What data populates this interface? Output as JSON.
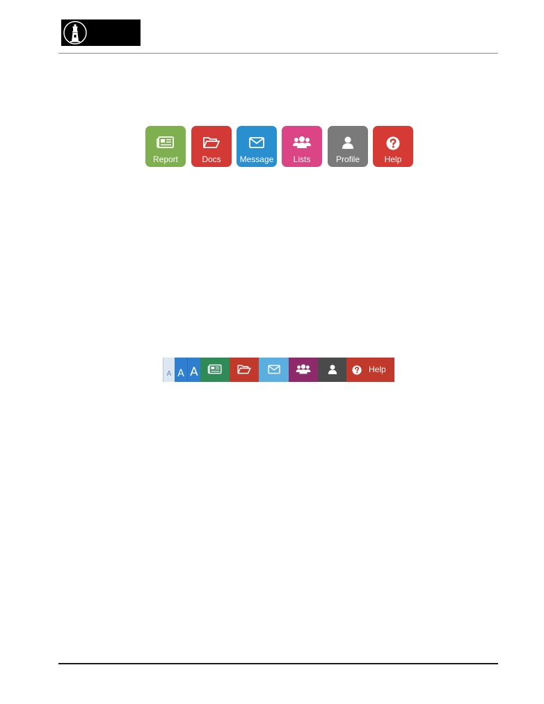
{
  "header": {
    "logo_icon": "lighthouse-icon"
  },
  "tiles": [
    {
      "label": "Report",
      "icon": "newspaper-icon",
      "color": "#7fb04f"
    },
    {
      "label": "Docs",
      "icon": "folder-open-icon",
      "color": "#d43a35"
    },
    {
      "label": "Message",
      "icon": "envelope-icon",
      "color": "#2a8fcf"
    },
    {
      "label": "Lists",
      "icon": "users-icon",
      "color": "#db4585"
    },
    {
      "label": "Profile",
      "icon": "user-icon",
      "color": "#7a7a7a"
    },
    {
      "label": "Help",
      "icon": "question-circle-icon",
      "color": "#d63a35"
    }
  ],
  "bar": {
    "font_sizes": [
      "A",
      "A",
      "A"
    ],
    "help_label": "Help",
    "colors": {
      "font_small": "#dbe7f3",
      "font_medium": "#2e7fd0",
      "font_large": "#2e7fd0",
      "report": "#2e8b57",
      "docs": "#c0392b",
      "message": "#5aaee0",
      "lists": "#8e2a6a",
      "profile": "#4a4a4a",
      "help": "#c0392b"
    }
  }
}
